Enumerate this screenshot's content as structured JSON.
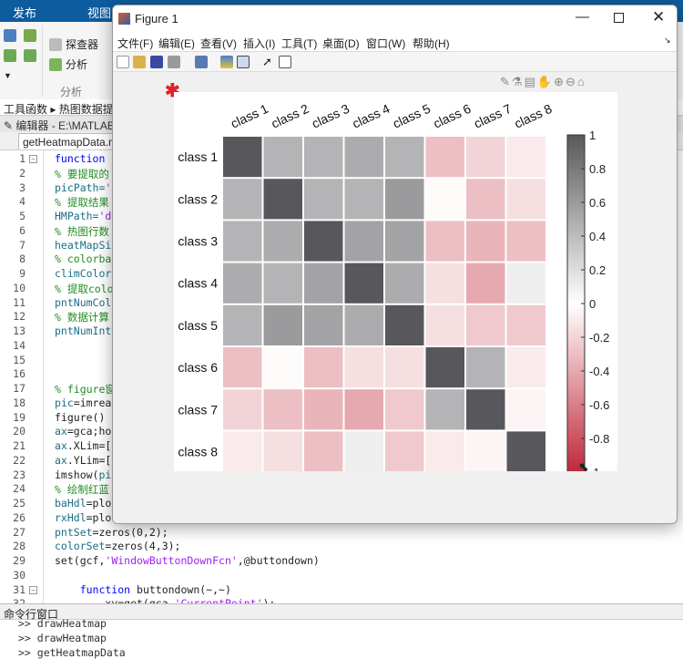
{
  "ribbon": {
    "tabs": [
      "发布",
      "视图"
    ],
    "explorer": "探查器",
    "analyze": "分析",
    "section": "分析"
  },
  "breadcrumb": [
    "工具函数",
    "热图数据提"
  ],
  "editor": {
    "title": "编辑器 - E:\\MATLAB",
    "tab": "getHeatmapData.m",
    "lines": [
      {
        "n": "1",
        "t": [
          [
            "function ",
            "kw"
          ]
        ]
      },
      {
        "n": "2",
        "t": [
          [
            "% 要提取的",
            "cm"
          ]
        ]
      },
      {
        "n": "3",
        "t": [
          [
            "picPath=",
            "vr"
          ],
          [
            "'",
            "st"
          ]
        ]
      },
      {
        "n": "4",
        "t": [
          [
            "% 提取结果",
            "cm"
          ]
        ]
      },
      {
        "n": "5",
        "t": [
          [
            "HMPath=",
            "vr"
          ],
          [
            "'da",
            "st"
          ]
        ]
      },
      {
        "n": "6",
        "t": [
          [
            "% 热图行数",
            "cm"
          ]
        ]
      },
      {
        "n": "7",
        "t": [
          [
            "heatMapSi",
            "vr"
          ]
        ]
      },
      {
        "n": "8",
        "t": [
          [
            "% colorba",
            "cm"
          ]
        ]
      },
      {
        "n": "9",
        "t": [
          [
            "climColorb",
            "vr"
          ]
        ]
      },
      {
        "n": "10",
        "t": [
          [
            "% 提取colo",
            "cm"
          ]
        ]
      },
      {
        "n": "11",
        "t": [
          [
            "pntNumColo",
            "vr"
          ]
        ]
      },
      {
        "n": "12",
        "t": [
          [
            "% 数据计算",
            "cm"
          ]
        ]
      },
      {
        "n": "13",
        "t": [
          [
            "pntNumInte",
            "vr"
          ]
        ]
      },
      {
        "n": "14",
        "t": []
      },
      {
        "n": "15",
        "t": []
      },
      {
        "n": "16",
        "t": []
      },
      {
        "n": "17",
        "t": [
          [
            "% figure窗",
            "cm"
          ]
        ]
      },
      {
        "n": "18",
        "t": [
          [
            "pic",
            "vr"
          ],
          [
            "=imreac",
            "tx"
          ]
        ]
      },
      {
        "n": "19",
        "t": [
          [
            "figure()",
            "tx"
          ]
        ]
      },
      {
        "n": "20",
        "t": [
          [
            "ax",
            "vr"
          ],
          [
            "=gca;hol",
            "tx"
          ]
        ]
      },
      {
        "n": "21",
        "t": [
          [
            "ax",
            "vr"
          ],
          [
            ".XLim=[",
            "tx"
          ]
        ]
      },
      {
        "n": "22",
        "t": [
          [
            "ax",
            "vr"
          ],
          [
            ".YLim=[",
            "tx"
          ]
        ]
      },
      {
        "n": "23",
        "t": [
          [
            "imshow(",
            "tx"
          ],
          [
            "pic",
            "vr"
          ]
        ]
      },
      {
        "n": "24",
        "t": [
          [
            "% 绘制红蓝",
            "cm"
          ]
        ]
      },
      {
        "n": "25",
        "t": [
          [
            "baHdl",
            "vr"
          ],
          [
            "=plot",
            "tx"
          ]
        ]
      },
      {
        "n": "26",
        "t": [
          [
            "rxHdl",
            "vr"
          ],
          [
            "=plot",
            "tx"
          ]
        ]
      },
      {
        "n": "27",
        "t": [
          [
            "pntSet",
            "vr"
          ],
          [
            "=zeros(0,2);",
            "tx"
          ]
        ]
      },
      {
        "n": "28",
        "t": [
          [
            "colorSet",
            "vr"
          ],
          [
            "=zeros(4,3);",
            "tx"
          ]
        ]
      },
      {
        "n": "29",
        "t": [
          [
            "set(gcf,",
            "tx"
          ],
          [
            "'WindowButtonDownFcn'",
            "st"
          ],
          [
            ",@buttondown)",
            "tx"
          ]
        ]
      },
      {
        "n": "30",
        "t": []
      },
      {
        "n": "31",
        "t": [
          [
            "    function ",
            "kw"
          ],
          [
            "buttondown(~,~)",
            "tx"
          ]
        ]
      },
      {
        "n": "32",
        "t": [
          [
            "        xy=get(gca,",
            "tx"
          ],
          [
            "'CurrentPoint'",
            "st"
          ],
          [
            ");",
            "tx"
          ]
        ]
      }
    ]
  },
  "command": {
    "title": "命令行窗口",
    "lines": [
      ">> drawHeatmap",
      ">> drawHeatmap",
      ">> getHeatmapData"
    ]
  },
  "figure": {
    "title": "Figure 1",
    "menu": [
      "文件(F)",
      "编辑(E)",
      "查看(V)",
      "插入(I)",
      "工具(T)",
      "桌面(D)",
      "窗口(W)",
      "帮助(H)"
    ]
  },
  "chart_data": {
    "type": "heatmap",
    "x_labels": [
      "class 1",
      "class 2",
      "class 3",
      "class 4",
      "class 5",
      "class 6",
      "class 7",
      "class 8"
    ],
    "y_labels": [
      "class 1",
      "class 2",
      "class 3",
      "class 4",
      "class 5",
      "class 6",
      "class 7",
      "class 8"
    ],
    "values": [
      [
        1,
        0.45,
        0.45,
        0.5,
        0.45,
        -0.3,
        -0.2,
        -0.1
      ],
      [
        0.45,
        1,
        0.45,
        0.45,
        0.6,
        -0.02,
        -0.3,
        -0.15
      ],
      [
        0.45,
        0.5,
        1,
        0.55,
        0.55,
        -0.3,
        -0.35,
        -0.3
      ],
      [
        0.5,
        0.45,
        0.55,
        1,
        0.5,
        -0.15,
        -0.4,
        0.1
      ],
      [
        0.45,
        0.6,
        0.55,
        0.5,
        1,
        -0.15,
        -0.25,
        -0.25
      ],
      [
        -0.3,
        -0.02,
        -0.3,
        -0.15,
        -0.15,
        1,
        0.45,
        -0.1
      ],
      [
        -0.2,
        -0.3,
        -0.35,
        -0.4,
        -0.25,
        0.45,
        1,
        -0.05
      ],
      [
        -0.1,
        -0.15,
        -0.3,
        0.1,
        -0.25,
        -0.1,
        -0.05,
        1
      ]
    ],
    "clim": [
      -1,
      1
    ],
    "colorbar_ticks": [
      "1",
      "0.8",
      "0.6",
      "0.4",
      "0.2",
      "0",
      "-0.2",
      "-0.4",
      "-0.6",
      "-0.8",
      "-1"
    ],
    "colormap": {
      "high": "#58575b",
      "mid": "#ffffff",
      "low": "#c0283a"
    }
  }
}
